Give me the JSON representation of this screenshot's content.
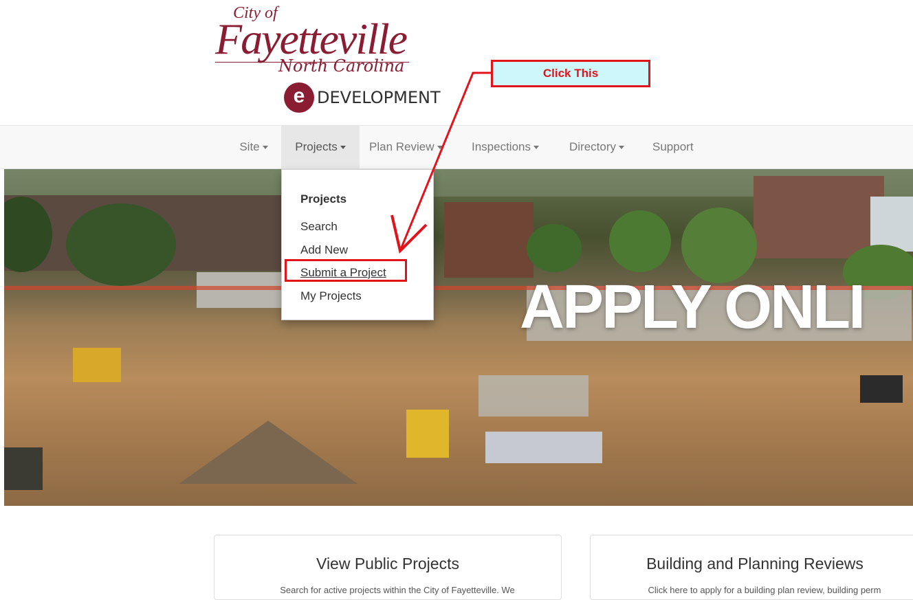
{
  "logo": {
    "city_of": "City of",
    "name": "Fayetteville",
    "state": "North Carolina",
    "e_letter": "e",
    "product": "DEVELOPMENT"
  },
  "nav": {
    "items": [
      {
        "label": "Site"
      },
      {
        "label": "Projects"
      },
      {
        "label": "Plan Review"
      },
      {
        "label": "Inspections"
      },
      {
        "label": "Directory"
      },
      {
        "label": "Support"
      }
    ]
  },
  "dropdown": {
    "header": "Projects",
    "items": [
      {
        "label": "Search"
      },
      {
        "label": "Add New"
      },
      {
        "label": "Submit a Project"
      },
      {
        "label": "My Projects"
      }
    ]
  },
  "annotation": {
    "callout": "Click This",
    "color": "#e3131c"
  },
  "hero": {
    "banner": "APPLY ONLI"
  },
  "cards": [
    {
      "title": "View Public Projects",
      "desc": "Search for active projects within the City of Fayetteville.  We"
    },
    {
      "title": "Building and Planning Reviews",
      "desc": "Click here to apply for a building plan review, building perm"
    }
  ]
}
